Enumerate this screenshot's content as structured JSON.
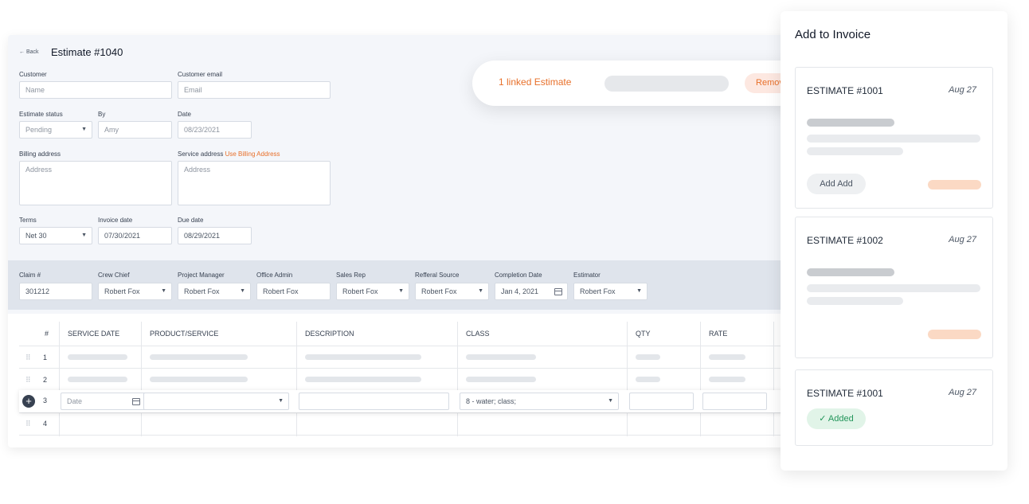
{
  "estimate": {
    "back_label": "Back",
    "back_arrow": "←",
    "title": "Estimate #1040",
    "customer_label": "Customer",
    "customer_placeholder": "Name",
    "email_label": "Customer email",
    "email_placeholder": "Email",
    "status_label": "Estimate status",
    "status_value": "Pending",
    "by_label": "By",
    "by_value": "Amy",
    "date_label": "Date",
    "date_value": "08/23/2021",
    "billing_label": "Billing address",
    "billing_placeholder": "Address",
    "service_label": "Service address",
    "use_billing_label": "Use Billing Address",
    "service_placeholder": "Address",
    "terms_label": "Terms",
    "terms_value": "Net 30",
    "invoice_date_label": "Invoice date",
    "invoice_date_value": "07/30/2021",
    "due_date_label": "Due date",
    "due_date_value": "08/29/2021"
  },
  "details": {
    "claim_label": "Claim #",
    "claim_value": "301212",
    "crew_chief_label": "Crew Chief",
    "crew_chief_value": "Robert Fox",
    "project_manager_label": "Project Manager",
    "project_manager_value": "Robert Fox",
    "office_admin_label": "Office Admin",
    "office_admin_value": "Robert Fox",
    "sales_rep_label": "Sales Rep",
    "sales_rep_value": "Robert Fox",
    "referral_label": "Refferal Source",
    "referral_value": "Robert Fox",
    "completion_label": "Completion Date",
    "completion_value": "Jan 4, 2021",
    "estimator_label": "Estimator",
    "estimator_value": "Robert Fox"
  },
  "table": {
    "headers": [
      "#",
      "SERVICE DATE",
      "PRODUCT/SERVICE",
      "DESCRIPTION",
      "CLASS",
      "QTY",
      "RATE"
    ],
    "row_numbers": [
      "1",
      "2",
      "3",
      "4"
    ],
    "edit_row": {
      "date_placeholder": "Date",
      "class_value": "8 - water; class;"
    }
  },
  "linked": {
    "label": "1 linked Estimate",
    "remove_label": "Remove"
  },
  "panel": {
    "title": "Add to Invoice",
    "estimates": [
      {
        "name": "ESTIMATE #1001",
        "date": "Aug 27",
        "button": "Add Add"
      },
      {
        "name": "ESTIMATE #1002",
        "date": "Aug 27"
      },
      {
        "name": "ESTIMATE #1001",
        "date": "Aug 27",
        "status": "Added",
        "status_icon": "✓"
      }
    ]
  },
  "colors": {
    "accent_orange": "#e8702a",
    "added_green": "#22955a"
  }
}
